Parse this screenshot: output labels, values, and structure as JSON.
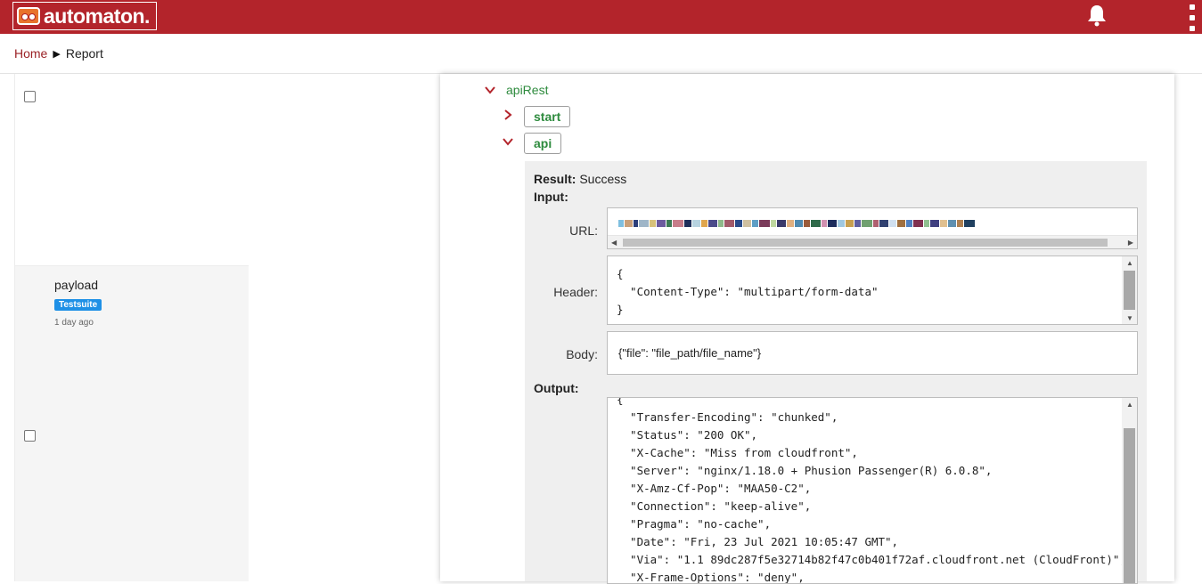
{
  "app": {
    "name": "automaton."
  },
  "breadcrumb": {
    "home": "Home",
    "separator": "▶",
    "current": "Report"
  },
  "list": {
    "items": [
      {
        "title": "",
        "badge": "",
        "time": ""
      },
      {
        "title": "payload",
        "badge": "Testsuite",
        "time": "1 day ago"
      }
    ]
  },
  "tree": {
    "root": "apiRest",
    "children": [
      {
        "label": "start",
        "expanded": false
      },
      {
        "label": "api",
        "expanded": true
      }
    ]
  },
  "detail": {
    "result_label": "Result:",
    "result_value": "Success",
    "input_label": "Input:",
    "url_label": "URL:",
    "header_label": "Header:",
    "header_value": "{\n  \"Content-Type\": \"multipart/form-data\"\n}",
    "body_label": "Body:",
    "body_value": "{\"file\": \"file_path/file_name\"}",
    "output_label": "Output:",
    "output_value": "{\n  \"Transfer-Encoding\": \"chunked\",\n  \"Status\": \"200 OK\",\n  \"X-Cache\": \"Miss from cloudfront\",\n  \"Server\": \"nginx/1.18.0 + Phusion Passenger(R) 6.0.8\",\n  \"X-Amz-Cf-Pop\": \"MAA50-C2\",\n  \"Connection\": \"keep-alive\",\n  \"Pragma\": \"no-cache\",\n  \"Date\": \"Fri, 23 Jul 2021 10:05:47 GMT\",\n  \"Via\": \"1.1 89dc287f5e32714b82f47c0b401f72af.cloudfront.net (CloudFront)\",\n  \"X-Frame-Options\": \"deny\","
  },
  "colors": {
    "brand": "#b3242b",
    "tree_green": "#2e8b3e",
    "badge_blue": "#1e90e6"
  },
  "icons": {
    "logo": "robot-logo-icon",
    "notifications": "bell-icon",
    "menu": "kebab-menu-icon"
  }
}
